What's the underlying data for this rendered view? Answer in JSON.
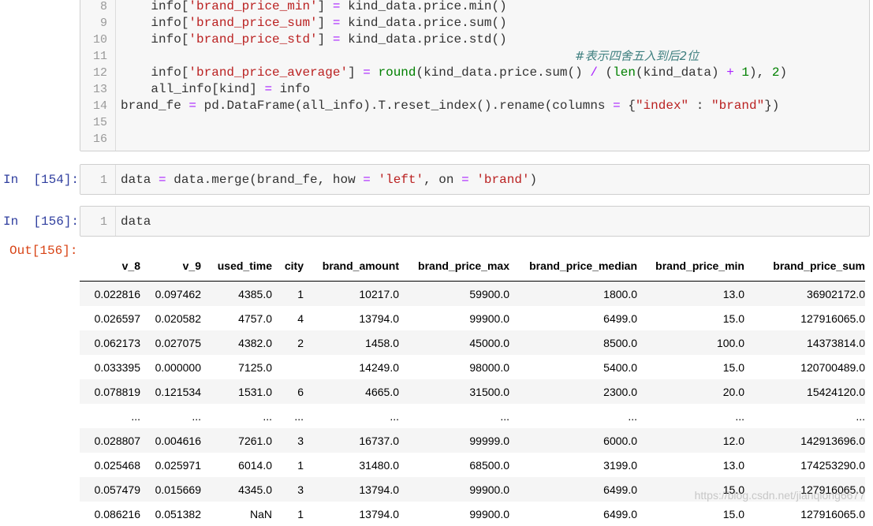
{
  "cell1": {
    "lines": [
      {
        "n": "8",
        "code": "    info['brand_price_min'] = kind_data.price.min()"
      },
      {
        "n": "9",
        "code": "    info['brand_price_sum'] = kind_data.price.sum()"
      },
      {
        "n": "10",
        "code": "    info['brand_price_std'] = kind_data.price.std()"
      },
      {
        "n": "11",
        "comment": "#表示四舍五入到后2位"
      },
      {
        "n": "12",
        "code": "    info['brand_price_average'] = round(kind_data.price.sum() / (len(kind_data) + 1), 2)"
      },
      {
        "n": "13",
        "code": "    all_info[kind] = info"
      },
      {
        "n": "14",
        "code": "brand_fe = pd.DataFrame(all_info).T.reset_index().rename(columns = {\"index\" : \"brand\"})"
      },
      {
        "n": "15",
        "code": ""
      },
      {
        "n": "16",
        "code": ""
      }
    ]
  },
  "cell2": {
    "prompt": "In  [154]:",
    "line_no": "1",
    "code": "data = data.merge(brand_fe, how = 'left', on = 'brand')"
  },
  "cell3": {
    "prompt": "In  [156]:",
    "line_no": "1",
    "code": "data",
    "out_prompt": "Out[156]:"
  },
  "table": {
    "columns": [
      "v_8",
      "v_9",
      "used_time",
      "city",
      "brand_amount",
      "brand_price_max",
      "brand_price_median",
      "brand_price_min",
      "brand_price_sum"
    ],
    "rows": [
      [
        "0.022816",
        "0.097462",
        "4385.0",
        "1",
        "10217.0",
        "59900.0",
        "1800.0",
        "13.0",
        "36902172.0"
      ],
      [
        "0.026597",
        "0.020582",
        "4757.0",
        "4",
        "13794.0",
        "99900.0",
        "6499.0",
        "15.0",
        "127916065.0"
      ],
      [
        "0.062173",
        "0.027075",
        "4382.0",
        "2",
        "1458.0",
        "45000.0",
        "8500.0",
        "100.0",
        "14373814.0"
      ],
      [
        "0.033395",
        "0.000000",
        "7125.0",
        "",
        "14249.0",
        "98000.0",
        "5400.0",
        "15.0",
        "120700489.0"
      ],
      [
        "0.078819",
        "0.121534",
        "1531.0",
        "6",
        "4665.0",
        "31500.0",
        "2300.0",
        "20.0",
        "15424120.0"
      ],
      [
        "...",
        "...",
        "...",
        "...",
        "...",
        "...",
        "...",
        "...",
        "..."
      ],
      [
        "0.028807",
        "0.004616",
        "7261.0",
        "3",
        "16737.0",
        "99999.0",
        "6000.0",
        "12.0",
        "142913696.0"
      ],
      [
        "0.025468",
        "0.025971",
        "6014.0",
        "1",
        "31480.0",
        "68500.0",
        "3199.0",
        "13.0",
        "174253290.0"
      ],
      [
        "0.057479",
        "0.015669",
        "4345.0",
        "3",
        "13794.0",
        "99900.0",
        "6499.0",
        "15.0",
        "127916065.0"
      ],
      [
        "0.086216",
        "0.051382",
        "NaN",
        "1",
        "13794.0",
        "99900.0",
        "6499.0",
        "15.0",
        "127916065.0"
      ]
    ]
  },
  "watermark": "https://blog.csdn.net/jianqiong6677"
}
